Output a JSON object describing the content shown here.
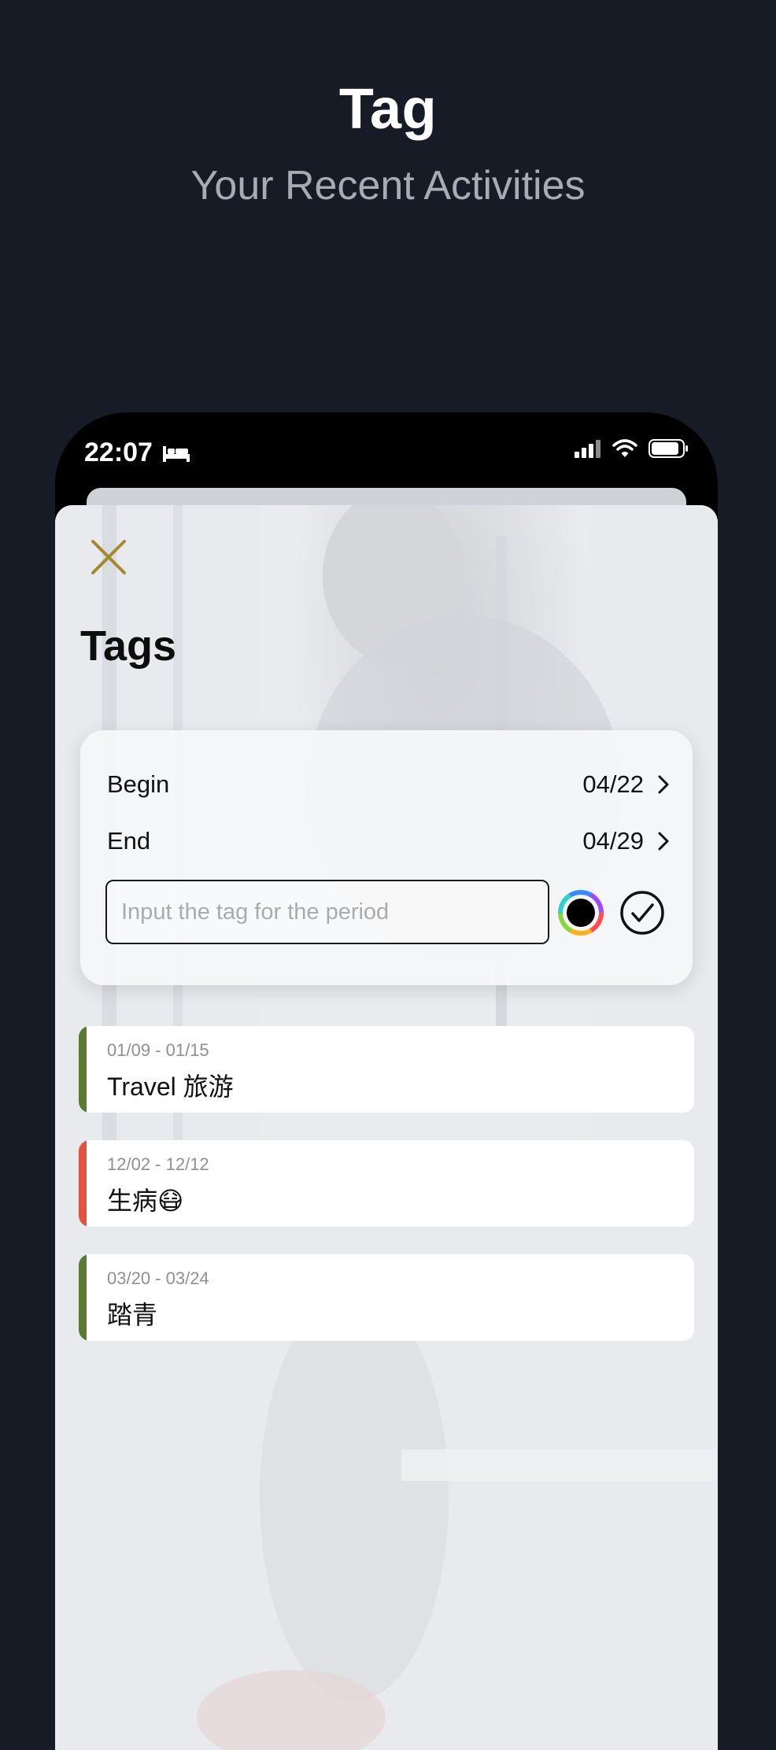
{
  "hero": {
    "title": "Tag",
    "subtitle": "Your Recent Activities"
  },
  "status_bar": {
    "time": "22:07",
    "icons": [
      "bed-icon",
      "cellular-icon",
      "wifi-icon",
      "battery-icon"
    ]
  },
  "sheet": {
    "close_icon": "close-icon",
    "title": "Tags",
    "accent_color": "#a48a2f"
  },
  "period": {
    "begin_label": "Begin",
    "begin_value": "04/22",
    "end_label": "End",
    "end_value": "04/29",
    "input_value": "",
    "input_placeholder": "Input the tag for the period",
    "selected_color": "#000000"
  },
  "tags": [
    {
      "dates": "01/09 - 01/15",
      "name": "Travel 旅游",
      "color": "#5a7a32"
    },
    {
      "dates": "12/02 - 12/12",
      "name": "生病😷",
      "color": "#e25440"
    },
    {
      "dates": "03/20 - 03/24",
      "name": "踏青",
      "color": "#5a7a32"
    }
  ]
}
